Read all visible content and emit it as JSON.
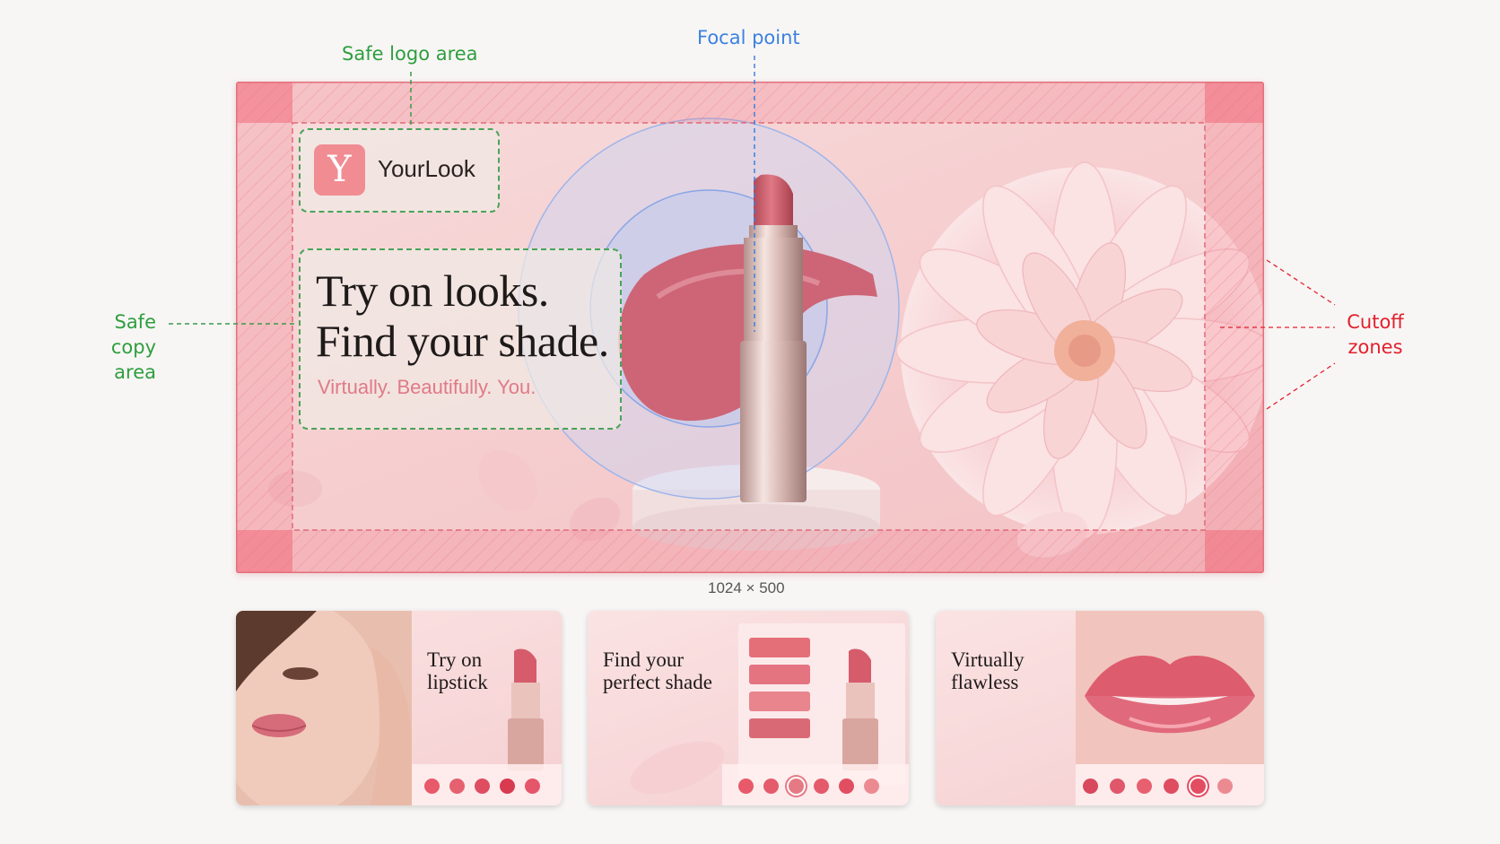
{
  "annotations": {
    "safe_logo": "Safe logo area",
    "focal_point": "Focal point",
    "safe_copy_line1": "Safe copy",
    "safe_copy_line2": "area",
    "cutoff_line1": "Cutoff",
    "cutoff_line2": "zones",
    "colors": {
      "safe": "#2e9e3e",
      "focal": "#3b82e0",
      "cutoff": "#e3202c"
    }
  },
  "banner": {
    "logo_letter": "Y",
    "brand": "YourLook",
    "headline_line1": "Try on looks.",
    "headline_line2": "Find your shade.",
    "tagline": "Virtually. Beautifully. You.",
    "size_caption": "1024 × 500"
  },
  "cards": [
    {
      "title": "Try on\nlipstick",
      "swatches": [
        "#e8596a",
        "#e56170",
        "#de4d60",
        "#d83a50",
        "#e5566a"
      ],
      "selected": -1
    },
    {
      "title": "Find your\nperfect shade",
      "swatches": [
        "#e8596a",
        "#e45b6c",
        "#e57a84",
        "#e45a6b",
        "#e24e61",
        "#ec8a92"
      ],
      "selected": 2
    },
    {
      "title": "Virtually\nflawless",
      "swatches": [
        "#d9495d",
        "#e0566a",
        "#e8606f",
        "#de4d60",
        "#e24d61",
        "#ec8a92"
      ],
      "selected": 4
    }
  ],
  "colors": {
    "accent": "#f08c92",
    "cutoff_fill": "#f06a7a",
    "swatch_panel": [
      "#e56f79",
      "#e47480",
      "#e8858d",
      "#d96a75"
    ]
  }
}
